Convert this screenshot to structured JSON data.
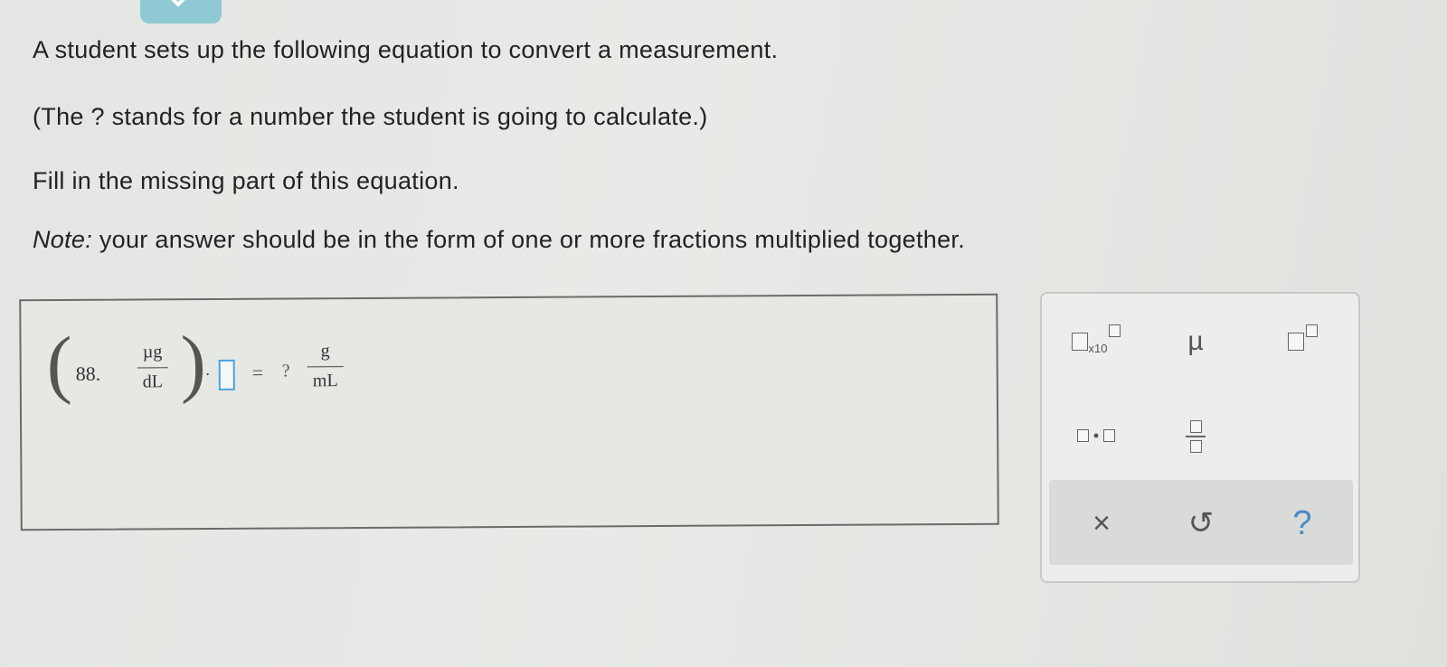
{
  "prompt": {
    "line1": "A student sets up the following equation to convert a measurement.",
    "line2": "(The ? stands for a number the student is going to calculate.)",
    "line3": "Fill in the missing part of this equation.",
    "note_label": "Note:",
    "note_text": " your answer should be in the form of one or more fractions multiplied together."
  },
  "equation": {
    "paren_left": "(",
    "paren_right": ")",
    "number": "88.",
    "frac1_numerator": "µg",
    "frac1_denominator": "dL",
    "dot": "·",
    "equals": "=",
    "unknown": "?",
    "frac2_numerator": "g",
    "frac2_denominator": "mL"
  },
  "palette": {
    "x10_label": "x10",
    "mu_label": "µ",
    "dot_label": "•",
    "clear_label": "×",
    "undo_label": "↺",
    "help_label": "?"
  },
  "colors": {
    "accent": "#4aa2e0",
    "help_blue": "#4a89c6",
    "tab_teal": "#8fc9d4"
  }
}
